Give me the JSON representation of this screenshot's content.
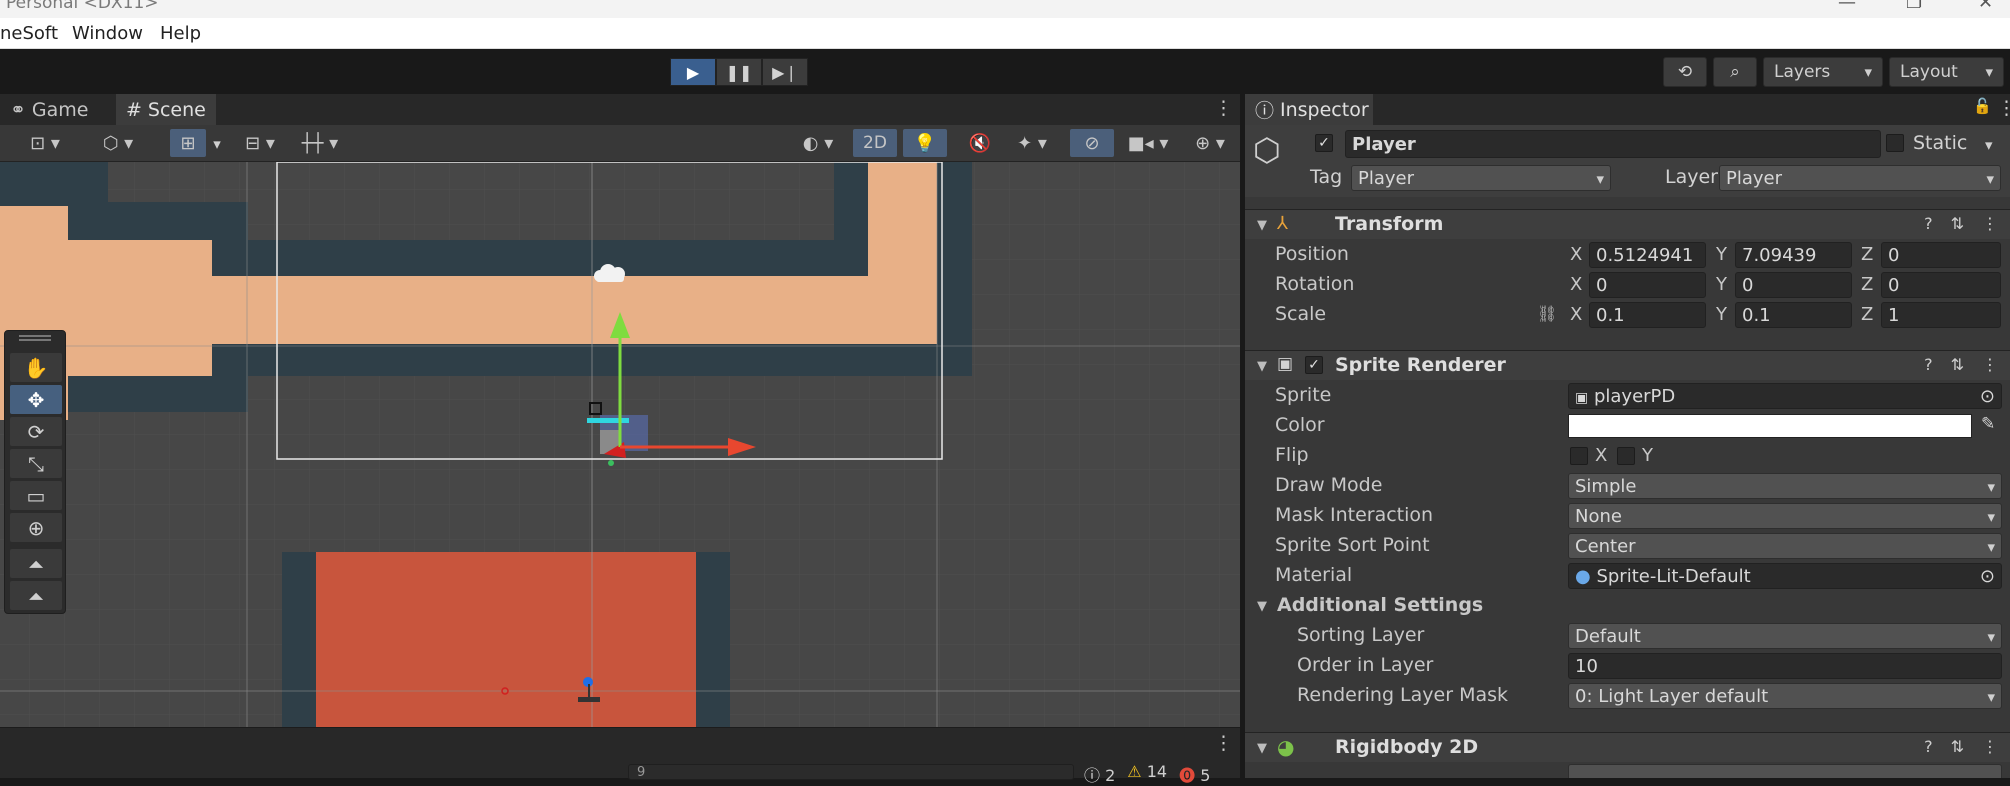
{
  "window": {
    "title": "Personal <DX11>"
  },
  "menu": {
    "items": [
      "neSoft",
      "Window",
      "Help"
    ]
  },
  "toolbar": {
    "layers_label": "Layers",
    "layout_label": "Layout"
  },
  "scene": {
    "tabs": [
      {
        "label": "Game",
        "icon": "gamepad-icon"
      },
      {
        "label": "Scene",
        "icon": "hash-icon"
      }
    ],
    "mode_2d": "2D",
    "search_value": "9"
  },
  "console": {
    "info_count": "2",
    "warn_count": "14",
    "error_count": "5"
  },
  "inspector": {
    "tab_label": "Inspector",
    "object": {
      "name": "Player",
      "static_label": "Static",
      "tag_label": "Tag",
      "tag_value": "Player",
      "layer_label": "Layer",
      "layer_value": "Player"
    },
    "transform": {
      "title": "Transform",
      "position_label": "Position",
      "rotation_label": "Rotation",
      "scale_label": "Scale",
      "pos": {
        "x": "0.5124941",
        "y": "7.09439",
        "z": "0"
      },
      "rot": {
        "x": "0",
        "y": "0",
        "z": "0"
      },
      "scl": {
        "x": "0.1",
        "y": "0.1",
        "z": "1"
      }
    },
    "axes": {
      "x": "X",
      "y": "Y",
      "z": "Z"
    },
    "sprite_renderer": {
      "title": "Sprite Renderer",
      "sprite_label": "Sprite",
      "sprite_value": "playerPD",
      "color_label": "Color",
      "color_value": "#ffffff",
      "flip_label": "Flip",
      "draw_mode_label": "Draw Mode",
      "draw_mode_value": "Simple",
      "mask_label": "Mask Interaction",
      "mask_value": "None",
      "sort_point_label": "Sprite Sort Point",
      "sort_point_value": "Center",
      "material_label": "Material",
      "material_value": "Sprite-Lit-Default",
      "additional_label": "Additional Settings",
      "sorting_layer_label": "Sorting Layer",
      "sorting_layer_value": "Default",
      "order_label": "Order in Layer",
      "order_value": "10",
      "rlm_label": "Rendering Layer Mask",
      "rlm_value": "0: Light Layer default"
    },
    "rigidbody": {
      "title": "Rigidbody 2D"
    }
  },
  "colors": {
    "accent": "#3a5f8f",
    "platform_peach": "#e8b087",
    "platform_red": "#c8553d",
    "tile_dark": "#2f3f48",
    "gizmo_y": "#7fdc3f",
    "gizmo_x": "#e8472f"
  }
}
